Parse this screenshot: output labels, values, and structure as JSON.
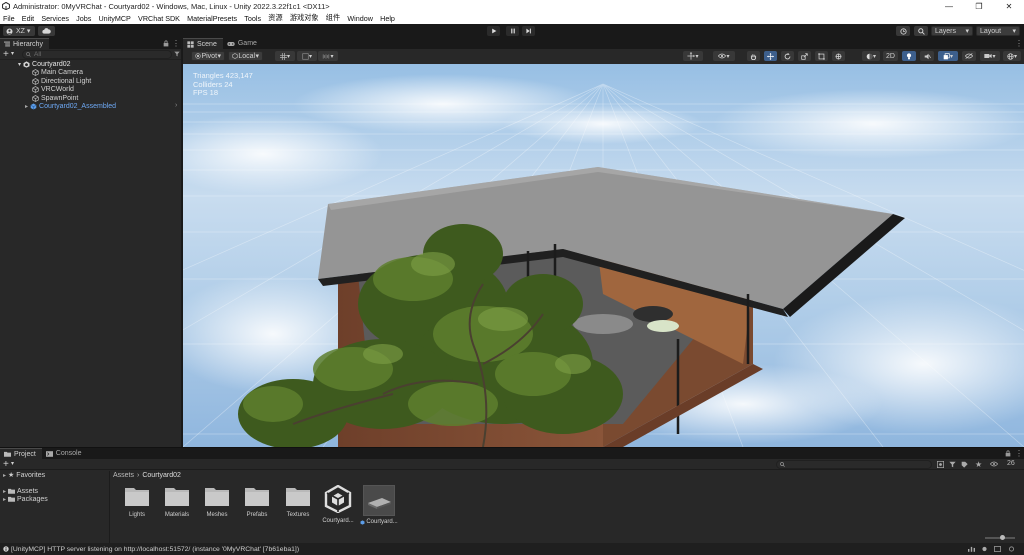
{
  "window": {
    "title": "Administrator: 0MyVRChat - Courtyard02 - Windows, Mac, Linux - Unity 2022.3.22f1c1 <DX11>",
    "controls": [
      "—",
      "❐",
      "✕"
    ]
  },
  "menu": [
    "File",
    "Edit",
    "Services",
    "Jobs",
    "UnityMCP",
    "VRChat SDK",
    "MaterialPresets",
    "Tools",
    "资源",
    "游戏对象",
    "组件",
    "Window",
    "Help"
  ],
  "toolbar": {
    "account": "XZ ▾",
    "layers": "Layers",
    "layout": "Layout"
  },
  "hierarchy": {
    "tab": "Hierarchy",
    "search_placeholder": "All",
    "scene_name": "Courtyard02",
    "items": [
      "Main Camera",
      "Directional Light",
      "VRCWorld",
      "SpawnPoint"
    ],
    "prefab_item": "Courtyard02_Assembled"
  },
  "scene": {
    "tabs": [
      "Scene",
      "Game"
    ],
    "pivot": "Pivot",
    "local": "Local",
    "mode2d": "2D",
    "stats": {
      "triangles": "Triangles 423,147",
      "colliders": "Colliders 24",
      "fps": "FPS 18"
    }
  },
  "project": {
    "tabs": [
      "Project",
      "Console"
    ],
    "favorites": "Favorites",
    "tree": [
      "Assets",
      "Packages"
    ],
    "breadcrumb": [
      "Assets",
      "Courtyard02"
    ],
    "item_count": "26",
    "assets": [
      "Lights",
      "Materials",
      "Meshes",
      "Prefabs",
      "Textures",
      "Courtyard...",
      "Courtyard..."
    ]
  },
  "status": {
    "message": "[UnityMCP] HTTP server listening on http://localhost:51572/  (instance '0MyVRChat' [7b61eba1])"
  },
  "colors": {
    "panel": "#282828",
    "dark": "#191919",
    "accent": "#3d7ad6",
    "prefab_blue": "#6ea9f5",
    "sky": "#a9c9e6"
  }
}
